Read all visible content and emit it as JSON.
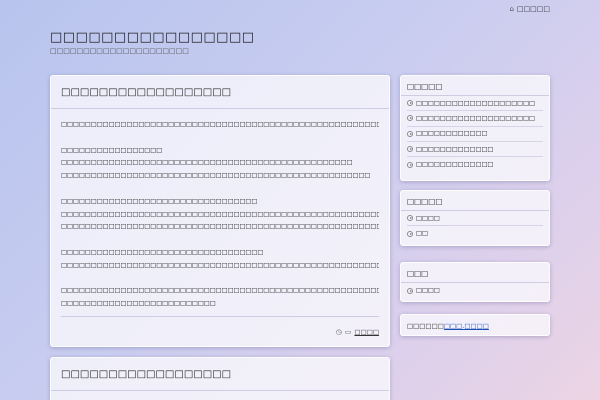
{
  "header": {
    "top_link": "□□□□□",
    "site_title": "□□□□□□□□□□□□□□□□",
    "site_desc": "□□□□□□□□□□□□□□□□□□□□□"
  },
  "posts": [
    {
      "title": "□□□□□□□□□□□□□□□□□□",
      "paragraphs": [
        [
          "□□□□□□□□□□□□□□□□□□□□□□□□□□□□□□□□□□□□□□□□□□□□□□□□□□□□□□□□□□□□□□□□□□□□"
        ],
        [
          "□□□□□□□□□□□□□□□□□",
          "□□□□□□□□□□□□□□□□□□□□□□□□□□□□□□□□□□□□□□□□□□□□□□□□□",
          "□□□□□□□□□□□□□□□□□□□□□□□□□□□□□□□□□□□□□□□□□□□□□□□□□□□□"
        ],
        [
          "□□□□□□□□□□□□□□□□□□□□□□□□□□□□□□□□□",
          "□□□□□□□□□□□□□□□□□□□□□□□□□□□□□□□□□□□□□□□□□□□□□□□□□□□□□□□□□□□□",
          "□□□□□□□□□□□□□□□□□□□□□□□□□□□□□□□□□□□□□□□□□□□□□□□□□□□□□□□□□□□□□□□□□□□□□□□□□□□□"
        ],
        [
          "□□□□□□□□□□□□□□□□□□□□□□□□□□□□□□□□□□",
          "□□□□□□□□□□□□□□□□□□□□□□□□□□□□□□□□□□□□□□□□□□□□□□□□□□□□□□□□□□□□□□□□□□□□□"
        ],
        [
          "□□□□□□□□□□□□□□□□□□□□□□□□□□□□□□□□□□□□□□□□□□□□□□□□□□□□□□□□□□□□□□□□□□□□□□□□□□□□□□□□□□□□□",
          "□□□□□□□□□□□□□□□□□□□□□□□□□□"
        ]
      ],
      "category": "□□□□"
    },
    {
      "title": "□□□□□□□□□□□□□□□□□□"
    }
  ],
  "sidebar": {
    "widget1": {
      "title": "□□□□□",
      "items": [
        "□□□□□□□□□□□□□□□□□□□□",
        "□□□□□□□□□□□□□□□□□□□□",
        "□□□□□□□□□□□□",
        "□□□□□□□□□□□□□",
        "□□□□□□□□□□□□□"
      ]
    },
    "widget2": {
      "title": "□□□□□",
      "items": [
        "□□□□",
        "□□"
      ]
    },
    "widget3": {
      "title": "□□□",
      "items": [
        "□□□□"
      ]
    },
    "widget4": {
      "prefix": "□□□□□□",
      "link": "□□□.□□□□"
    }
  }
}
